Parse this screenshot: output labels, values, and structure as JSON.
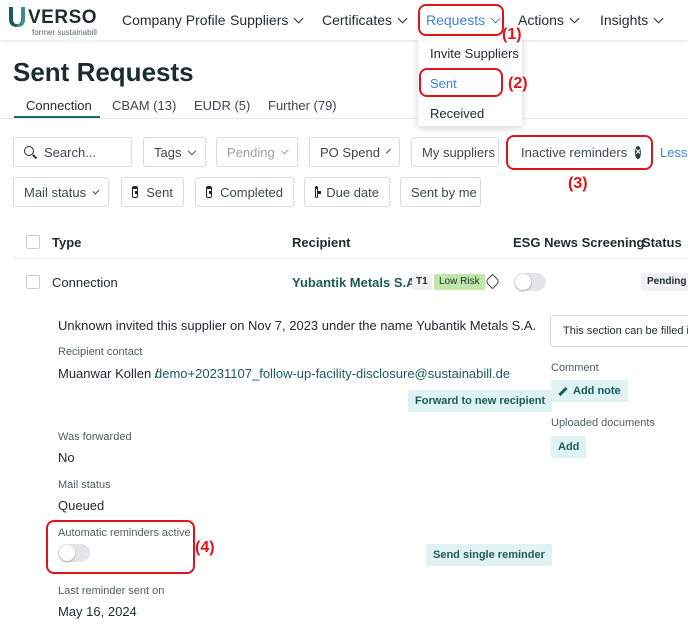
{
  "brand": {
    "name": "VERSO",
    "tagline": "former sustainabill"
  },
  "nav": [
    {
      "label": "Company Profile",
      "has_menu": false
    },
    {
      "label": "Suppliers",
      "has_menu": true
    },
    {
      "label": "Certificates",
      "has_menu": true
    },
    {
      "label": "Requests",
      "has_menu": true,
      "active": true
    },
    {
      "label": "Actions",
      "has_menu": true
    },
    {
      "label": "Insights",
      "has_menu": true
    }
  ],
  "requests_menu": {
    "items": [
      "Invite Suppliers",
      "Sent",
      "Received"
    ],
    "selected": "Sent"
  },
  "page": {
    "title": "Sent Requests"
  },
  "tabs": [
    {
      "label": "Connection",
      "active": true
    },
    {
      "label": "CBAM (13)"
    },
    {
      "label": "EUDR (5)"
    },
    {
      "label": "Further (79)"
    }
  ],
  "filters": {
    "search_placeholder": "Search...",
    "tags": "Tags",
    "pending": "Pending",
    "po_spend": "PO Spend",
    "my_suppliers": "My suppliers",
    "inactive_reminders": "Inactive reminders",
    "less": "Less",
    "mail_status": "Mail status",
    "sent": "Sent",
    "completed": "Completed",
    "due_date": "Due date",
    "sent_by_me": "Sent by me"
  },
  "table": {
    "headers": [
      "Type",
      "Recipient",
      "ESG News Screening",
      "Status"
    ],
    "row": {
      "type": "Connection",
      "recipient": "Yubantik Metals S.A.",
      "tier": "T1",
      "risk": "Low Risk",
      "status": "Pending"
    }
  },
  "details": {
    "invite_text": "Unknown invited this supplier on Nov 7, 2023 under the name Yubantik Metals S.A.",
    "recipient_contact_label": "Recipient contact",
    "contact_name": "Muanwar Kollen /",
    "contact_email": "demo+20231107_follow-up-facility-disclosure@sustainabill.de",
    "forward_button": "Forward to new recipient",
    "was_forwarded_label": "Was forwarded",
    "was_forwarded_value": "No",
    "mail_status_label": "Mail status",
    "mail_status_value": "Queued",
    "auto_reminders_label": "Automatic reminders active",
    "auto_reminders_on": false,
    "send_reminder_button": "Send single reminder",
    "last_reminder_label": "Last reminder sent on",
    "last_reminder_value": "May 16, 2024",
    "section_note": "This section can be filled in",
    "comment_label": "Comment",
    "add_note_button": "Add note",
    "uploaded_docs_label": "Uploaded documents",
    "add_button": "Add"
  },
  "annotations": [
    "(1)",
    "(2)",
    "(3)",
    "(4)"
  ],
  "colors": {
    "accent": "#3b86d6",
    "brand_teal": "#1d5a5a",
    "highlight_red": "#e0141e",
    "low_risk_green": "#bfe8a8"
  }
}
